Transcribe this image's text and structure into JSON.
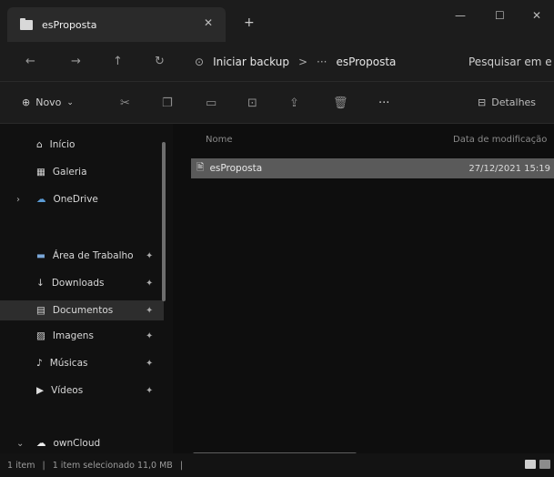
{
  "window": {
    "tab_title": "esProposta",
    "close_glyph": "✕",
    "new_tab_glyph": "+",
    "minimize_glyph": "—",
    "maximize_glyph": "☐",
    "close_window_glyph": "✕"
  },
  "nav": {
    "back_glyph": "←",
    "forward_glyph": "→",
    "up_glyph": "↑",
    "refresh_glyph": "↻",
    "address_crumbs": [
      "Iniciar backup",
      ">",
      "···",
      "esProposta"
    ],
    "search_placeholder": "Pesquisar em e"
  },
  "toolbar": {
    "new_label": "Novo",
    "details_label": "Detalhes",
    "more_glyph": "···"
  },
  "sidebar": {
    "items": [
      {
        "label": "Início",
        "icon": "home-icon"
      },
      {
        "label": "Galeria",
        "icon": "gallery-icon"
      },
      {
        "label": "OneDrive",
        "icon": "onedrive-icon"
      },
      {
        "label": "Área de Trabalho",
        "icon": "desktop-icon"
      },
      {
        "label": "Downloads",
        "icon": "download-icon"
      },
      {
        "label": "Documentos",
        "icon": "documents-icon"
      },
      {
        "label": "Imagens",
        "icon": "images-icon"
      },
      {
        "label": "Músicas",
        "icon": "music-icon"
      },
      {
        "label": "Vídeos",
        "icon": "videos-icon"
      },
      {
        "label": "ownCloud",
        "icon": "cloud-icon"
      }
    ]
  },
  "content": {
    "columns": [
      "Nome",
      "Data de modificação"
    ],
    "rows": [
      {
        "name": "esProposta",
        "date": "27/12/2021 15:19"
      }
    ]
  },
  "status": {
    "count": "1 item",
    "selection": "1 item selecionado  11,0 MB"
  },
  "colors": {
    "background": "#0c0c0c",
    "chrome": "#1c1c1c",
    "selected_row": "#5a5a5a"
  }
}
